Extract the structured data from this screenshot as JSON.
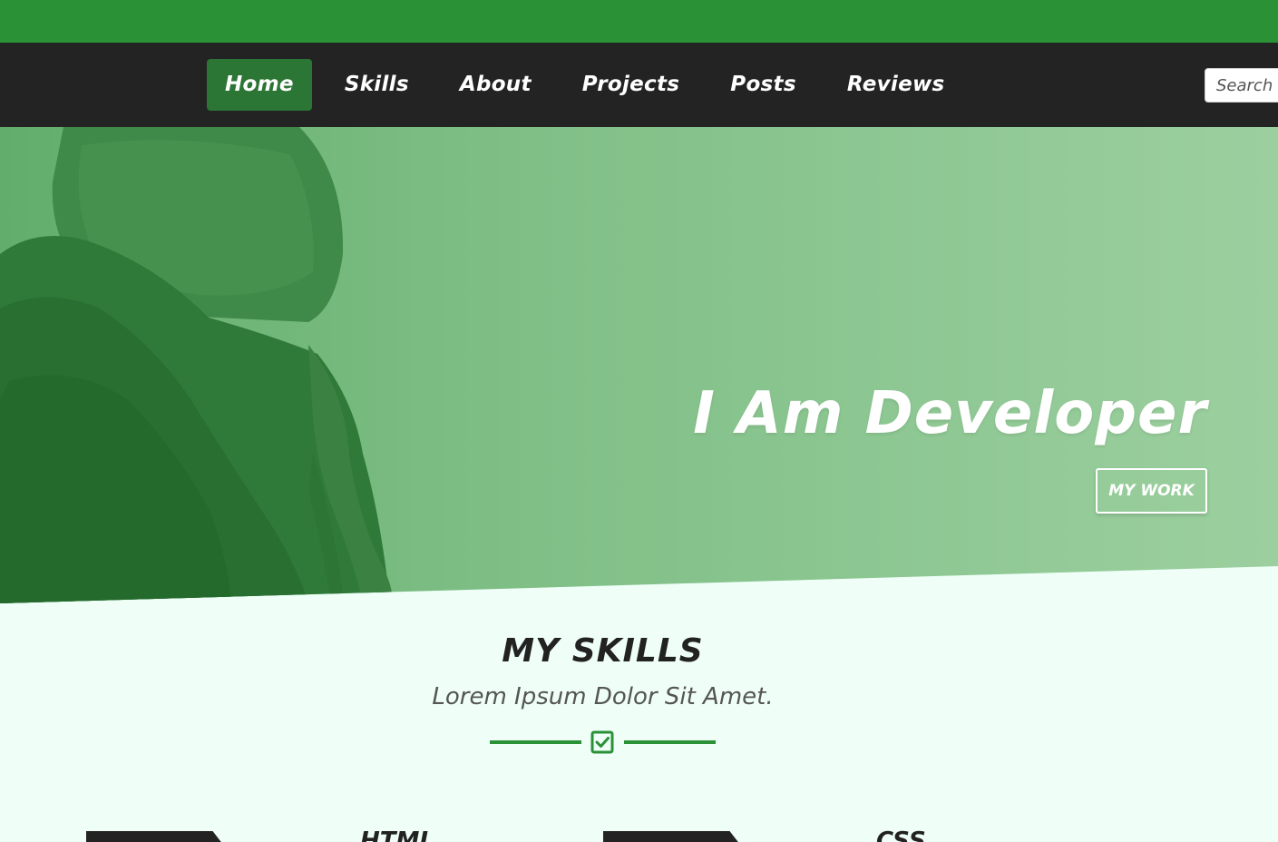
{
  "colors": {
    "accent": "#2a9137",
    "nav_background": "#232323",
    "nav_active": "#2b7535",
    "page_background": "#effff8"
  },
  "nav": {
    "items": [
      {
        "label": "Home",
        "active": true
      },
      {
        "label": "Skills",
        "active": false
      },
      {
        "label": "About",
        "active": false
      },
      {
        "label": "Projects",
        "active": false
      },
      {
        "label": "Posts",
        "active": false
      },
      {
        "label": "Reviews",
        "active": false
      }
    ],
    "search_placeholder": "Search"
  },
  "hero": {
    "title": "I Am Developer",
    "button_label": "MY WORK"
  },
  "skills": {
    "title": "MY SKILLS",
    "subtitle": "Lorem Ipsum Dolor Sit Amet.",
    "divider_icon": "check-square-icon",
    "cards": [
      {
        "label": "HTML"
      },
      {
        "label": "CSS"
      }
    ]
  }
}
